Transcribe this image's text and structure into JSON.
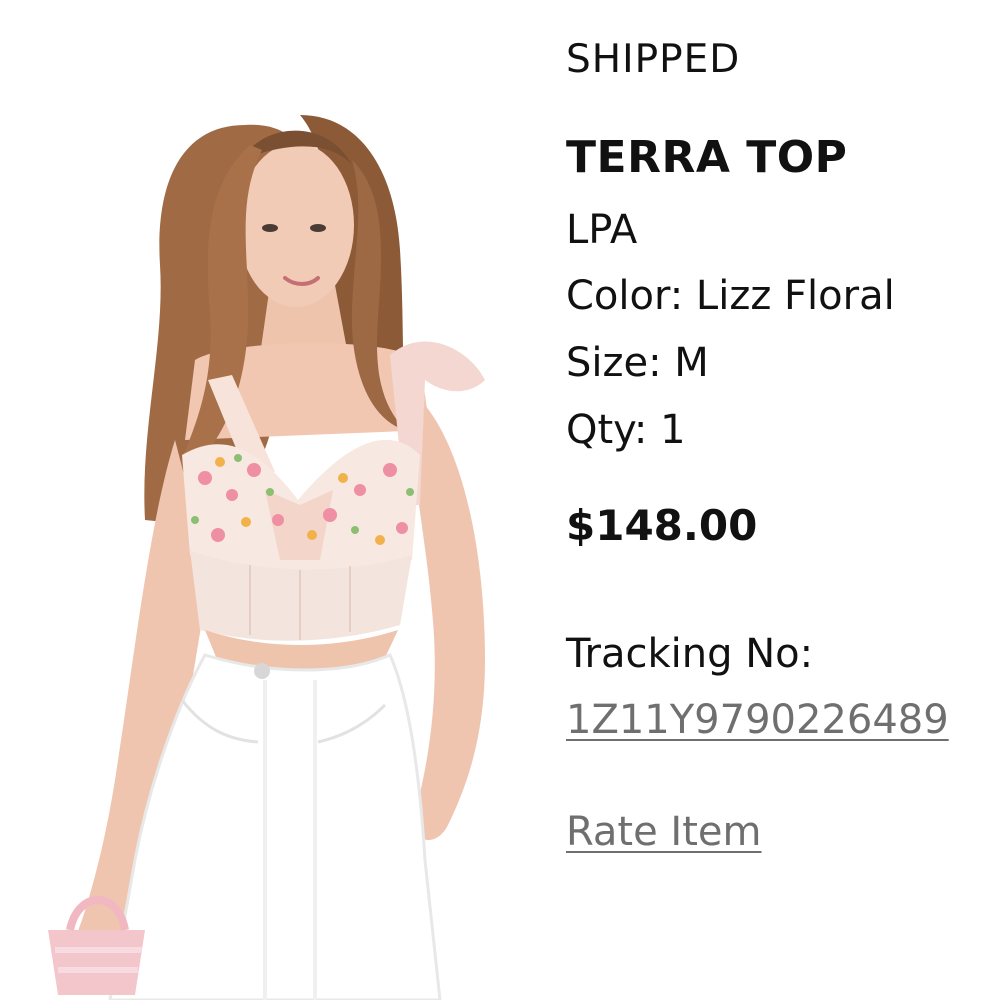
{
  "order_item": {
    "status": "SHIPPED",
    "name": "TERRA TOP",
    "brand": "LPA",
    "color": "Color: Lizz Floral",
    "size": "Size: M",
    "qty": "Qty: 1",
    "price": "$148.00",
    "tracking_label": "Tracking No:",
    "tracking_number": "1Z11Y9790226489",
    "rate_label": "Rate Item"
  },
  "colors": {
    "text": "#111111",
    "link": "#6f6f6f",
    "background": "#ffffff"
  },
  "icons": {
    "product_image": "product-photo"
  }
}
